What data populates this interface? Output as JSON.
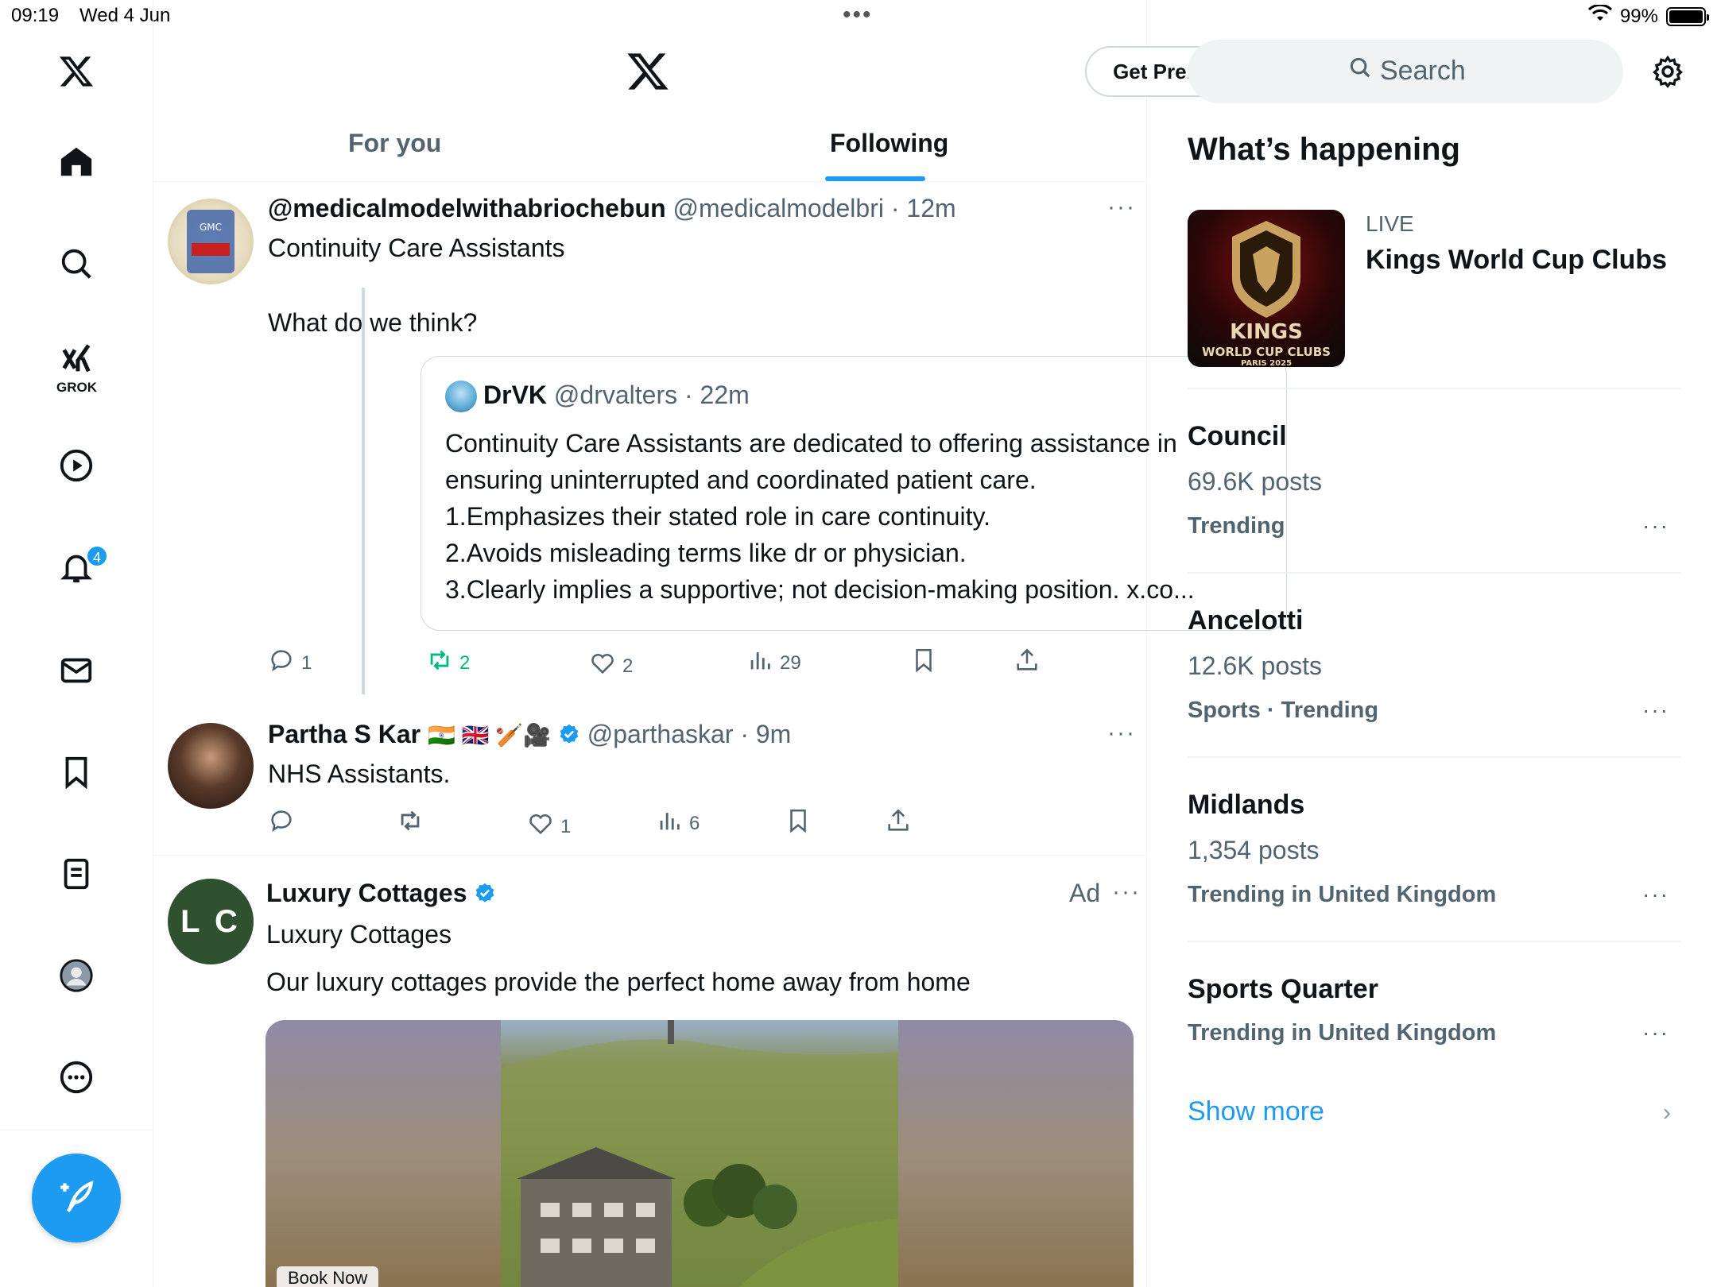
{
  "status_bar": {
    "time": "09:19",
    "date": "Wed 4 Jun",
    "battery": "99%",
    "battery_level": 0.99
  },
  "nav": {
    "grok_label": "GROK",
    "notifications_badge": "4",
    "icons": [
      "x-logo-icon",
      "home-icon",
      "search-icon",
      "grok-icon",
      "video-icon",
      "bell-icon",
      "mail-icon",
      "bookmark-icon",
      "lists-icon",
      "profile-icon",
      "more-icon",
      "compose-icon"
    ]
  },
  "header": {
    "get_premium": "Get Premium"
  },
  "tabs": {
    "for_you": "For you",
    "following": "Following"
  },
  "posts": [
    {
      "display_name": "@medicalmodelwithabriochebun",
      "handle": "@medicalmodelbri",
      "time": "· 12m",
      "text_line1": "Continuity Care Assistants",
      "text_line2": "What do we think?",
      "quote": {
        "display_name": "DrVK",
        "handle": "@drvalters",
        "time": "· 22m",
        "lines": [
          "Continuity Care Assistants are dedicated to offering assistance in",
          "ensuring uninterrupted and coordinated patient care.",
          "1.Emphasizes their stated role in care continuity.",
          "2.Avoids misleading terms like dr or physician.",
          "3.Clearly implies a supportive; not decision-making position. x.co..."
        ]
      },
      "stats": {
        "replies": "1",
        "reposts": "2",
        "likes": "2",
        "views": "29"
      }
    },
    {
      "display_name": "Partha S Kar",
      "emoji": "🇮🇳 🇬🇧 🏏🎥",
      "handle": "@parthaskar",
      "time": "· 9m",
      "text": "NHS Assistants.",
      "stats": {
        "replies": "",
        "reposts": "",
        "likes": "1",
        "views": "6"
      }
    },
    {
      "display_name": "Luxury Cottages",
      "avatar_initials": "L C",
      "ad_label": "Ad",
      "subtitle": "Luxury Cottages",
      "text": "Our luxury cottages provide the perfect home away from home",
      "cta": "Book Now"
    }
  ],
  "sidebar": {
    "search_placeholder": "Search",
    "heading": "What’s happening",
    "live": {
      "label": "LIVE",
      "title": "Kings World Cup Clubs",
      "image_text": [
        "KINGS",
        "WORLD CUP CLUBS",
        "PARIS 2025"
      ]
    },
    "trends": [
      {
        "title": "Council",
        "posts": "69.6K posts",
        "meta": "Trending"
      },
      {
        "title": "Ancelotti",
        "posts": "12.6K posts",
        "meta": "Sports · Trending"
      },
      {
        "title": "Midlands",
        "posts": "1,354 posts",
        "meta": "Trending in United Kingdom"
      },
      {
        "title": "Sports Quarter",
        "posts": "",
        "meta": "Trending in United Kingdom"
      }
    ],
    "show_more": "Show more"
  },
  "colors": {
    "accent": "#1d9bf0",
    "repost_active": "#00ba7c",
    "muted_text": "#536471",
    "avatar_green": "#2f5130"
  }
}
